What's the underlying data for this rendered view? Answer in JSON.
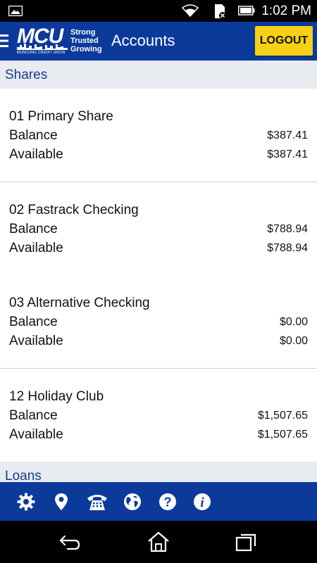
{
  "status_bar": {
    "time": "1:02 PM"
  },
  "header": {
    "logo_text": "MCU",
    "logo_subtext": "MUNICIPAL CREDIT UNION",
    "tagline": [
      "Strong",
      "Trusted",
      "Growing"
    ],
    "title": "Accounts",
    "logout_label": "LOGOUT"
  },
  "sections": {
    "shares": "Shares",
    "loans": "Loans"
  },
  "labels": {
    "balance": "Balance",
    "available": "Available"
  },
  "accounts": [
    {
      "name": "01 Primary Share",
      "balance": "$387.41",
      "available": "$387.41"
    },
    {
      "name": "02 Fastrack Checking",
      "balance": "$788.94",
      "available": "$788.94"
    },
    {
      "name": "03 Alternative Checking",
      "balance": "$0.00",
      "available": "$0.00"
    },
    {
      "name": "12 Holiday Club",
      "balance": "$1,507.65",
      "available": "$1,507.65"
    }
  ],
  "toolbar_icons": [
    "settings-icon",
    "location-icon",
    "phone-icon",
    "globe-icon",
    "help-icon",
    "info-icon"
  ],
  "nav_icons": [
    "back-icon",
    "home-icon",
    "recent-apps-icon"
  ],
  "colors": {
    "brand_blue": "#0b3a9b",
    "logout_yellow": "#f7d117",
    "section_bg": "#e8ebef"
  }
}
